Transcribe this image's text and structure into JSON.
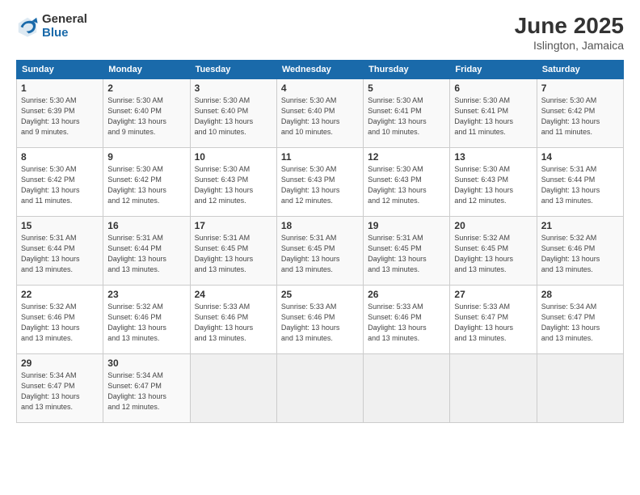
{
  "logo": {
    "general": "General",
    "blue": "Blue"
  },
  "title": {
    "month": "June 2025",
    "location": "Islington, Jamaica"
  },
  "days_header": [
    "Sunday",
    "Monday",
    "Tuesday",
    "Wednesday",
    "Thursday",
    "Friday",
    "Saturday"
  ],
  "weeks": [
    [
      {
        "day": "1",
        "info": "Sunrise: 5:30 AM\nSunset: 6:39 PM\nDaylight: 13 hours\nand 9 minutes."
      },
      {
        "day": "2",
        "info": "Sunrise: 5:30 AM\nSunset: 6:40 PM\nDaylight: 13 hours\nand 9 minutes."
      },
      {
        "day": "3",
        "info": "Sunrise: 5:30 AM\nSunset: 6:40 PM\nDaylight: 13 hours\nand 10 minutes."
      },
      {
        "day": "4",
        "info": "Sunrise: 5:30 AM\nSunset: 6:40 PM\nDaylight: 13 hours\nand 10 minutes."
      },
      {
        "day": "5",
        "info": "Sunrise: 5:30 AM\nSunset: 6:41 PM\nDaylight: 13 hours\nand 10 minutes."
      },
      {
        "day": "6",
        "info": "Sunrise: 5:30 AM\nSunset: 6:41 PM\nDaylight: 13 hours\nand 11 minutes."
      },
      {
        "day": "7",
        "info": "Sunrise: 5:30 AM\nSunset: 6:42 PM\nDaylight: 13 hours\nand 11 minutes."
      }
    ],
    [
      {
        "day": "8",
        "info": "Sunrise: 5:30 AM\nSunset: 6:42 PM\nDaylight: 13 hours\nand 11 minutes."
      },
      {
        "day": "9",
        "info": "Sunrise: 5:30 AM\nSunset: 6:42 PM\nDaylight: 13 hours\nand 12 minutes."
      },
      {
        "day": "10",
        "info": "Sunrise: 5:30 AM\nSunset: 6:43 PM\nDaylight: 13 hours\nand 12 minutes."
      },
      {
        "day": "11",
        "info": "Sunrise: 5:30 AM\nSunset: 6:43 PM\nDaylight: 13 hours\nand 12 minutes."
      },
      {
        "day": "12",
        "info": "Sunrise: 5:30 AM\nSunset: 6:43 PM\nDaylight: 13 hours\nand 12 minutes."
      },
      {
        "day": "13",
        "info": "Sunrise: 5:30 AM\nSunset: 6:43 PM\nDaylight: 13 hours\nand 12 minutes."
      },
      {
        "day": "14",
        "info": "Sunrise: 5:31 AM\nSunset: 6:44 PM\nDaylight: 13 hours\nand 13 minutes."
      }
    ],
    [
      {
        "day": "15",
        "info": "Sunrise: 5:31 AM\nSunset: 6:44 PM\nDaylight: 13 hours\nand 13 minutes."
      },
      {
        "day": "16",
        "info": "Sunrise: 5:31 AM\nSunset: 6:44 PM\nDaylight: 13 hours\nand 13 minutes."
      },
      {
        "day": "17",
        "info": "Sunrise: 5:31 AM\nSunset: 6:45 PM\nDaylight: 13 hours\nand 13 minutes."
      },
      {
        "day": "18",
        "info": "Sunrise: 5:31 AM\nSunset: 6:45 PM\nDaylight: 13 hours\nand 13 minutes."
      },
      {
        "day": "19",
        "info": "Sunrise: 5:31 AM\nSunset: 6:45 PM\nDaylight: 13 hours\nand 13 minutes."
      },
      {
        "day": "20",
        "info": "Sunrise: 5:32 AM\nSunset: 6:45 PM\nDaylight: 13 hours\nand 13 minutes."
      },
      {
        "day": "21",
        "info": "Sunrise: 5:32 AM\nSunset: 6:46 PM\nDaylight: 13 hours\nand 13 minutes."
      }
    ],
    [
      {
        "day": "22",
        "info": "Sunrise: 5:32 AM\nSunset: 6:46 PM\nDaylight: 13 hours\nand 13 minutes."
      },
      {
        "day": "23",
        "info": "Sunrise: 5:32 AM\nSunset: 6:46 PM\nDaylight: 13 hours\nand 13 minutes."
      },
      {
        "day": "24",
        "info": "Sunrise: 5:33 AM\nSunset: 6:46 PM\nDaylight: 13 hours\nand 13 minutes."
      },
      {
        "day": "25",
        "info": "Sunrise: 5:33 AM\nSunset: 6:46 PM\nDaylight: 13 hours\nand 13 minutes."
      },
      {
        "day": "26",
        "info": "Sunrise: 5:33 AM\nSunset: 6:46 PM\nDaylight: 13 hours\nand 13 minutes."
      },
      {
        "day": "27",
        "info": "Sunrise: 5:33 AM\nSunset: 6:47 PM\nDaylight: 13 hours\nand 13 minutes."
      },
      {
        "day": "28",
        "info": "Sunrise: 5:34 AM\nSunset: 6:47 PM\nDaylight: 13 hours\nand 13 minutes."
      }
    ],
    [
      {
        "day": "29",
        "info": "Sunrise: 5:34 AM\nSunset: 6:47 PM\nDaylight: 13 hours\nand 13 minutes."
      },
      {
        "day": "30",
        "info": "Sunrise: 5:34 AM\nSunset: 6:47 PM\nDaylight: 13 hours\nand 12 minutes."
      },
      {
        "day": "",
        "info": ""
      },
      {
        "day": "",
        "info": ""
      },
      {
        "day": "",
        "info": ""
      },
      {
        "day": "",
        "info": ""
      },
      {
        "day": "",
        "info": ""
      }
    ]
  ]
}
